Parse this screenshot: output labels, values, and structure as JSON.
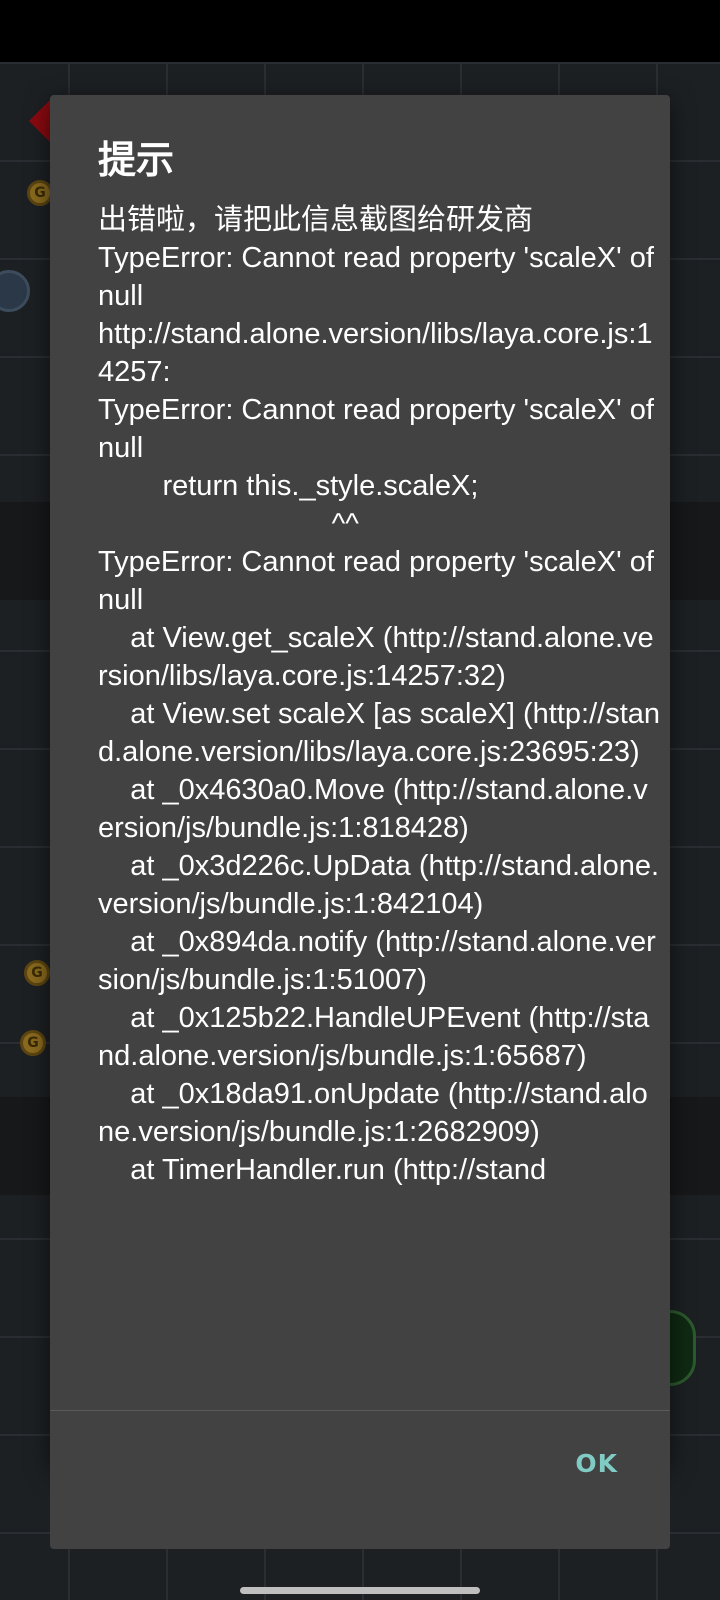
{
  "dialog": {
    "title": "提示",
    "message": "出错啦，请把此信息截图给研发商\nTypeError: Cannot read property 'scaleX' of null\nhttp://stand.alone.version/libs/laya.core.js:14257:\nTypeError: Cannot read property 'scaleX' of null\n        return this._style.scaleX;\n                             ^^\nTypeError: Cannot read property 'scaleX' of null\n    at View.get_scaleX (http://stand.alone.version/libs/laya.core.js:14257:32)\n    at View.set scaleX [as scaleX] (http://stand.alone.version/libs/laya.core.js:23695:23)\n    at _0x4630a0.Move (http://stand.alone.version/js/bundle.js:1:818428)\n    at _0x3d226c.UpData (http://stand.alone.version/js/bundle.js:1:842104)\n    at _0x894da.notify (http://stand.alone.version/js/bundle.js:1:51007)\n    at _0x125b22.HandleUPEvent (http://stand.alone.version/js/bundle.js:1:65687)\n    at _0x18da91.onUpdate (http://stand.alone.version/js/bundle.js:1:2682909)\n    at TimerHandler.run (http://stand",
    "ok_label": "OK"
  },
  "background": {
    "coin_glyph": "G"
  },
  "colors": {
    "dialog_bg": "#424242",
    "button_accent": "#80cbc4",
    "text": "#ffffff"
  }
}
